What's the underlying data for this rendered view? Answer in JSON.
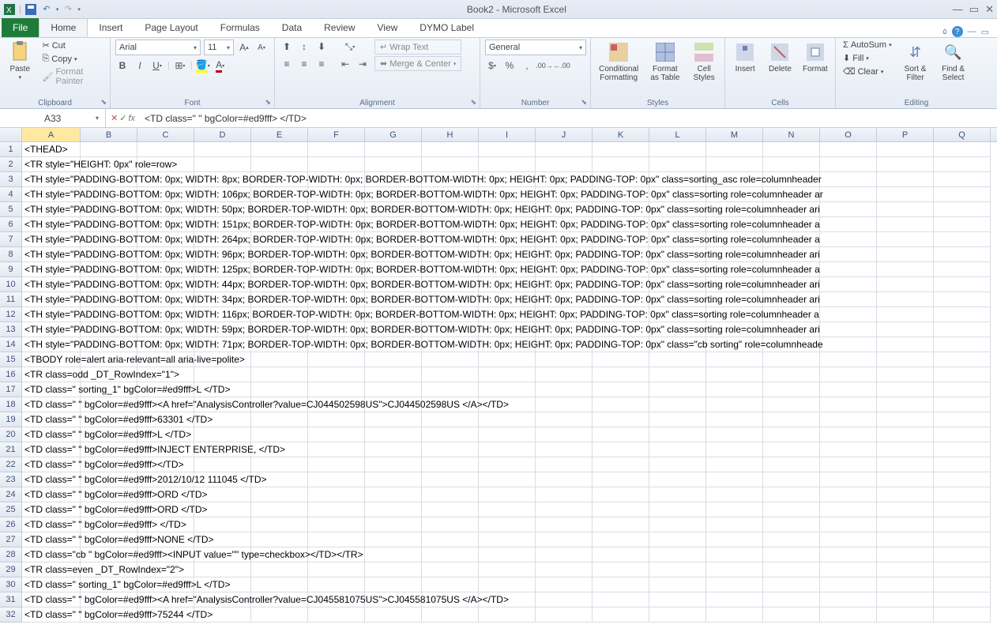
{
  "title": "Book2  -  Microsoft Excel",
  "qat": {
    "save_tip": "Save",
    "undo_tip": "Undo",
    "redo_tip": "Redo"
  },
  "tabs": {
    "file": "File",
    "list": [
      "Home",
      "Insert",
      "Page Layout",
      "Formulas",
      "Data",
      "Review",
      "View",
      "DYMO Label"
    ],
    "active": 0
  },
  "ribbon": {
    "clipboard": {
      "label": "Clipboard",
      "paste": "Paste",
      "cut": "Cut",
      "copy": "Copy",
      "fp": "Format Painter"
    },
    "font": {
      "label": "Font",
      "name": "Arial",
      "size": "11"
    },
    "alignment": {
      "label": "Alignment",
      "wrap": "Wrap Text",
      "merge": "Merge & Center"
    },
    "number": {
      "label": "Number",
      "format": "General"
    },
    "styles": {
      "label": "Styles",
      "cond": "Conditional Formatting",
      "fat": "Format as Table",
      "cs": "Cell Styles"
    },
    "cells": {
      "label": "Cells",
      "ins": "Insert",
      "del": "Delete",
      "fmt": "Format"
    },
    "editing": {
      "label": "Editing",
      "sum": "AutoSum",
      "fill": "Fill",
      "clear": "Clear",
      "sort": "Sort & Filter",
      "find": "Find & Select"
    }
  },
  "formula_bar": {
    "name": "A33",
    "value": "<TD class=\" \" bgColor=#ed9fff> </TD>"
  },
  "columns": [
    "A",
    "B",
    "C",
    "D",
    "E",
    "F",
    "G",
    "H",
    "I",
    "J",
    "K",
    "L",
    "M",
    "N",
    "O",
    "P",
    "Q"
  ],
  "active_row": 33,
  "rows": [
    {
      "n": 1,
      "a": "<THEAD>"
    },
    {
      "n": 2,
      "a": "<TR style=\"HEIGHT: 0px\" role=row>"
    },
    {
      "n": 3,
      "a": "<TH style=\"PADDING-BOTTOM: 0px; WIDTH: 8px; BORDER-TOP-WIDTH: 0px; BORDER-BOTTOM-WIDTH: 0px; HEIGHT: 0px; PADDING-TOP: 0px\" class=sorting_asc role=columnheader"
    },
    {
      "n": 4,
      "a": "<TH style=\"PADDING-BOTTOM: 0px; WIDTH: 106px; BORDER-TOP-WIDTH: 0px; BORDER-BOTTOM-WIDTH: 0px; HEIGHT: 0px; PADDING-TOP: 0px\" class=sorting role=columnheader ar"
    },
    {
      "n": 5,
      "a": "<TH style=\"PADDING-BOTTOM: 0px; WIDTH: 50px; BORDER-TOP-WIDTH: 0px; BORDER-BOTTOM-WIDTH: 0px; HEIGHT: 0px; PADDING-TOP: 0px\" class=sorting role=columnheader ari"
    },
    {
      "n": 6,
      "a": "<TH style=\"PADDING-BOTTOM: 0px; WIDTH: 151px; BORDER-TOP-WIDTH: 0px; BORDER-BOTTOM-WIDTH: 0px; HEIGHT: 0px; PADDING-TOP: 0px\" class=sorting role=columnheader a"
    },
    {
      "n": 7,
      "a": "<TH style=\"PADDING-BOTTOM: 0px; WIDTH: 264px; BORDER-TOP-WIDTH: 0px; BORDER-BOTTOM-WIDTH: 0px; HEIGHT: 0px; PADDING-TOP: 0px\" class=sorting role=columnheader a"
    },
    {
      "n": 8,
      "a": "<TH style=\"PADDING-BOTTOM: 0px; WIDTH: 96px; BORDER-TOP-WIDTH: 0px; BORDER-BOTTOM-WIDTH: 0px; HEIGHT: 0px; PADDING-TOP: 0px\" class=sorting role=columnheader ari"
    },
    {
      "n": 9,
      "a": "<TH style=\"PADDING-BOTTOM: 0px; WIDTH: 125px; BORDER-TOP-WIDTH: 0px; BORDER-BOTTOM-WIDTH: 0px; HEIGHT: 0px; PADDING-TOP: 0px\" class=sorting role=columnheader a"
    },
    {
      "n": 10,
      "a": "<TH style=\"PADDING-BOTTOM: 0px; WIDTH: 44px; BORDER-TOP-WIDTH: 0px; BORDER-BOTTOM-WIDTH: 0px; HEIGHT: 0px; PADDING-TOP: 0px\" class=sorting role=columnheader ari"
    },
    {
      "n": 11,
      "a": "<TH style=\"PADDING-BOTTOM: 0px; WIDTH: 34px; BORDER-TOP-WIDTH: 0px; BORDER-BOTTOM-WIDTH: 0px; HEIGHT: 0px; PADDING-TOP: 0px\" class=sorting role=columnheader ari"
    },
    {
      "n": 12,
      "a": "<TH style=\"PADDING-BOTTOM: 0px; WIDTH: 116px; BORDER-TOP-WIDTH: 0px; BORDER-BOTTOM-WIDTH: 0px; HEIGHT: 0px; PADDING-TOP: 0px\" class=sorting role=columnheader a"
    },
    {
      "n": 13,
      "a": "<TH style=\"PADDING-BOTTOM: 0px; WIDTH: 59px; BORDER-TOP-WIDTH: 0px; BORDER-BOTTOM-WIDTH: 0px; HEIGHT: 0px; PADDING-TOP: 0px\" class=sorting role=columnheader ari"
    },
    {
      "n": 14,
      "a": "<TH style=\"PADDING-BOTTOM: 0px; WIDTH: 71px; BORDER-TOP-WIDTH: 0px; BORDER-BOTTOM-WIDTH: 0px; HEIGHT: 0px; PADDING-TOP: 0px\" class=\"cb sorting\" role=columnheade"
    },
    {
      "n": 15,
      "a": "<TBODY role=alert aria-relevant=all aria-live=polite>"
    },
    {
      "n": 16,
      "a": "<TR class=odd _DT_RowIndex=\"1\">"
    },
    {
      "n": 17,
      "a": "<TD class=\"  sorting_1\" bgColor=#ed9fff>L </TD>"
    },
    {
      "n": 18,
      "a": "<TD class=\" \" bgColor=#ed9fff><A href=\"AnalysisController?value=CJ044502598US\">CJ044502598US </A></TD>"
    },
    {
      "n": 19,
      "a": "<TD class=\" \" bgColor=#ed9fff>63301 </TD>"
    },
    {
      "n": 20,
      "a": "<TD class=\" \" bgColor=#ed9fff>L </TD>"
    },
    {
      "n": 21,
      "a": "<TD class=\" \" bgColor=#ed9fff>INJECT ENTERPRISE, </TD>"
    },
    {
      "n": 22,
      "a": "<TD class=\" \" bgColor=#ed9fff></TD>"
    },
    {
      "n": 23,
      "a": "<TD class=\" \" bgColor=#ed9fff>2012/10/12 111045 </TD>"
    },
    {
      "n": 24,
      "a": "<TD class=\" \" bgColor=#ed9fff>ORD </TD>"
    },
    {
      "n": 25,
      "a": "<TD class=\" \" bgColor=#ed9fff>ORD </TD>"
    },
    {
      "n": 26,
      "a": "<TD class=\" \" bgColor=#ed9fff> </TD>"
    },
    {
      "n": 27,
      "a": "<TD class=\" \" bgColor=#ed9fff>NONE </TD>"
    },
    {
      "n": 28,
      "a": "<TD class=\"cb \" bgColor=#ed9fff><INPUT value=\"\" type=checkbox></TD></TR>"
    },
    {
      "n": 29,
      "a": "<TR class=even _DT_RowIndex=\"2\">"
    },
    {
      "n": 30,
      "a": "<TD class=\"  sorting_1\" bgColor=#ed9fff>L </TD>"
    },
    {
      "n": 31,
      "a": "<TD class=\" \" bgColor=#ed9fff><A href=\"AnalysisController?value=CJ045581075US\">CJ045581075US </A></TD>"
    },
    {
      "n": 32,
      "a": "<TD class=\" \" bgColor=#ed9fff>75244 </TD>"
    }
  ]
}
